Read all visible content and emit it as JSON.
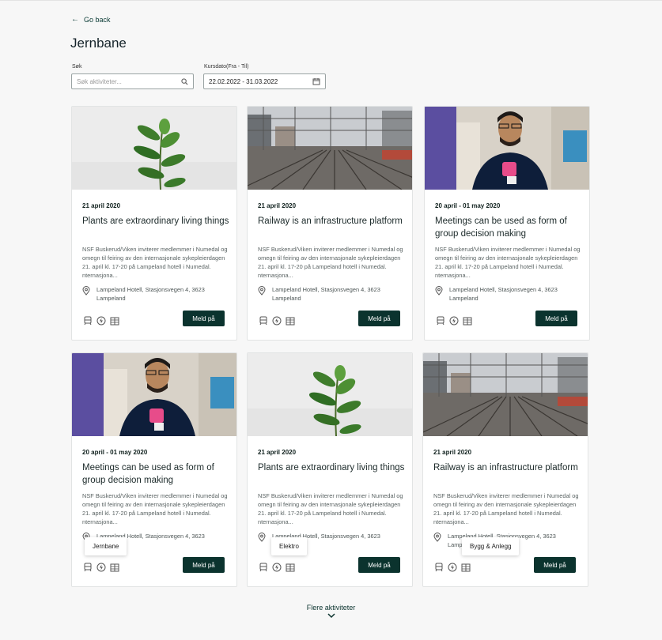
{
  "nav": {
    "go_back_label": "Go back"
  },
  "page": {
    "title": "Jernbane"
  },
  "search": {
    "label": "Søk",
    "placeholder": "Søk aktiviteter..."
  },
  "date_filter": {
    "label": "Kursdato(Fra - Til)",
    "value": "22.02.2022 - 31.03.2022"
  },
  "cards": [
    {
      "image": "plant",
      "date": "21 april 2020",
      "title": "Plants are extraordinary living things",
      "description": "NSF Buskerud/Viken inviterer medlemmer i Numedal og omegn til feiring av den internasjonale sykepleierdagen 21. april kl. 17-20 på Lampeland hotell i Numedal. nternasjona...",
      "location_line1": "Lampeland Hotell, Stasjonsvegen 4, 3623",
      "location_line2": "Lampeland",
      "button": "Meld på",
      "icons": [
        "train-icon",
        "bolt-icon",
        "building-icon"
      ]
    },
    {
      "image": "railway",
      "date": "21 april 2020",
      "title": "Railway is an infrastructure platform",
      "description": "NSF Buskerud/Viken inviterer medlemmer i Numedal og omegn til feiring av den internasjonale sykepleierdagen 21. april kl. 17-20 på Lampeland hotell i Numedal. nternasjona...",
      "location_line1": "Lampeland Hotell, Stasjonsvegen 4, 3623",
      "location_line2": "Lampeland",
      "button": "Meld på",
      "icons": [
        "train-icon",
        "bolt-icon",
        "building-icon"
      ]
    },
    {
      "image": "person",
      "date": "20 april - 01 may 2020",
      "title": "Meetings can be used as form of group decision making",
      "description": "NSF Buskerud/Viken inviterer medlemmer i Numedal og omegn til feiring av den internasjonale sykepleierdagen 21. april kl. 17-20 på Lampeland hotell i Numedal. nternasjona...",
      "location_line1": "Lampeland Hotell, Stasjonsvegen 4, 3623",
      "location_line2": "Lampeland",
      "button": "Meld på",
      "icons": [
        "train-icon",
        "bolt-icon",
        "building-icon"
      ]
    },
    {
      "image": "person",
      "date": "20 april - 01 may 2020",
      "title": "Meetings can be used as form of group decision making",
      "description": "NSF Buskerud/Viken inviterer medlemmer i Numedal og omegn til feiring av den internasjonale sykepleierdagen 21. april kl. 17-20 på Lampeland hotell i Numedal. nternasjona...",
      "location_line1": "Lampeland Hotell, Stasjonsvegen 4, 3623",
      "location_line2": "",
      "button": "Meld på",
      "icons": [
        "train-icon",
        "bolt-icon",
        "building-icon"
      ],
      "tooltip": "Jernbane"
    },
    {
      "image": "plant",
      "date": "21 april 2020",
      "title": "Plants are extraordinary living things",
      "description": "NSF Buskerud/Viken inviterer medlemmer i Numedal og omegn til feiring av den internasjonale sykepleierdagen 21. april kl. 17-20 på Lampeland hotell i Numedal. nternasjona...",
      "location_line1": "Lampeland Hotell, Stasjonsvegen 4, 3623",
      "location_line2": "",
      "button": "Meld på",
      "icons": [
        "train-icon",
        "bolt-icon",
        "building-icon"
      ],
      "tooltip": "Elektro"
    },
    {
      "image": "railway",
      "date": "21 april 2020",
      "title": "Railway is an infrastructure platform",
      "description": "NSF Buskerud/Viken inviterer medlemmer i Numedal og omegn til feiring av den internasjonale sykepleierdagen 21. april kl. 17-20 på Lampeland hotell i Numedal. nternasjona...",
      "location_line1": "Lampeland Hotell, Stasjonsvegen 4, 3623",
      "location_line2": "Lamp",
      "button": "Meld på",
      "icons": [
        "train-icon",
        "bolt-icon",
        "building-icon"
      ],
      "tooltip": "Bygg & Anlegg"
    }
  ],
  "load_more": {
    "label": "Flere aktiviteter"
  },
  "colors": {
    "primary": "#0b332e",
    "background": "#f7f7f7"
  }
}
